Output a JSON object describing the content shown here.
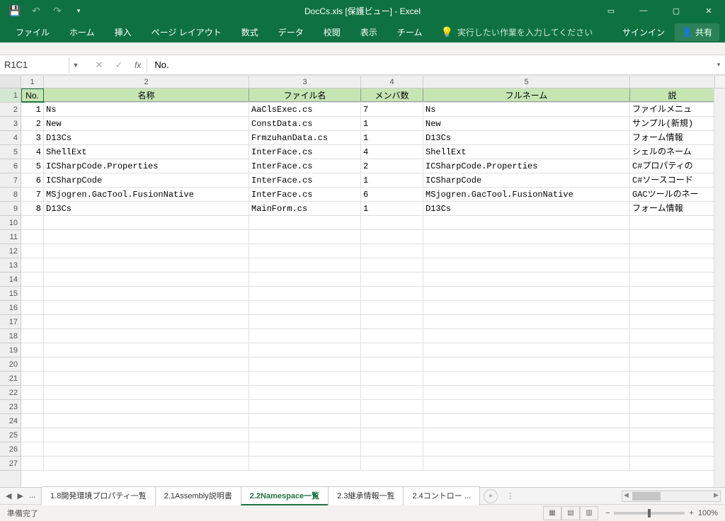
{
  "title": "DocCs.xls [保護ビュー] - Excel",
  "qat": {
    "save": "💾",
    "undo": "↶",
    "redo": "↷",
    "menu": "▾"
  },
  "win": {
    "ribbon_opts": "▭",
    "min": "—",
    "max": "▢",
    "close": "✕"
  },
  "tabs": [
    "ファイル",
    "ホーム",
    "挿入",
    "ページ レイアウト",
    "数式",
    "データ",
    "校閲",
    "表示",
    "チーム"
  ],
  "tell_me": "実行したい作業を入力してください",
  "signin": "サインイン",
  "share": "共有",
  "name_box": "R1C1",
  "formula_value": "No.",
  "col_headers": [
    "1",
    "2",
    "3",
    "4",
    "5",
    ""
  ],
  "header_row": [
    "No.",
    "名称",
    "ファイル名",
    "メンバ数",
    "フルネーム",
    "説"
  ],
  "rows": [
    {
      "no": "1",
      "name": "Ns",
      "file": "AaClsExec.cs",
      "members": "7",
      "full": "Ns",
      "desc": "ファイルメニュ"
    },
    {
      "no": "2",
      "name": "New",
      "file": "ConstData.cs",
      "members": "1",
      "full": "New",
      "desc": "サンプル(新規)"
    },
    {
      "no": "3",
      "name": "D13Cs",
      "file": "FrmzuhanData.cs",
      "members": "1",
      "full": "D13Cs",
      "desc": "フォーム情報"
    },
    {
      "no": "4",
      "name": "ShellExt",
      "file": "InterFace.cs",
      "members": "4",
      "full": "ShellExt",
      "desc": "シェルのネーム"
    },
    {
      "no": "5",
      "name": "ICSharpCode.Properties",
      "file": "InterFace.cs",
      "members": "2",
      "full": "ICSharpCode.Properties",
      "desc": "C#プロパティの"
    },
    {
      "no": "6",
      "name": "ICSharpCode",
      "file": "InterFace.cs",
      "members": "1",
      "full": "ICSharpCode",
      "desc": "C#ソースコード"
    },
    {
      "no": "7",
      "name": "MSjogren.GacTool.FusionNative",
      "file": "InterFace.cs",
      "members": "6",
      "full": "MSjogren.GacTool.FusionNative",
      "desc": "GACツールのネー"
    },
    {
      "no": "8",
      "name": "D13Cs",
      "file": "MainForm.cs",
      "members": "1",
      "full": "D13Cs",
      "desc": "フォーム情報"
    }
  ],
  "empty_rows": 18,
  "row_numbers": [
    "1",
    "2",
    "3",
    "4",
    "5",
    "6",
    "7",
    "8",
    "9",
    "10",
    "11",
    "12",
    "13",
    "14",
    "15",
    "16",
    "17",
    "18",
    "19",
    "20",
    "21",
    "22",
    "23",
    "24",
    "25",
    "26",
    "27"
  ],
  "sheet_tabs": {
    "dots": "...",
    "items": [
      "1.8開発環境プロパティ一覧",
      "2.1Assembly説明書",
      "2.2Namespace一覧",
      "2.3継承情報一覧",
      "2.4コントロー ..."
    ],
    "active_index": 2
  },
  "status": "準備完了",
  "zoom": "100%"
}
